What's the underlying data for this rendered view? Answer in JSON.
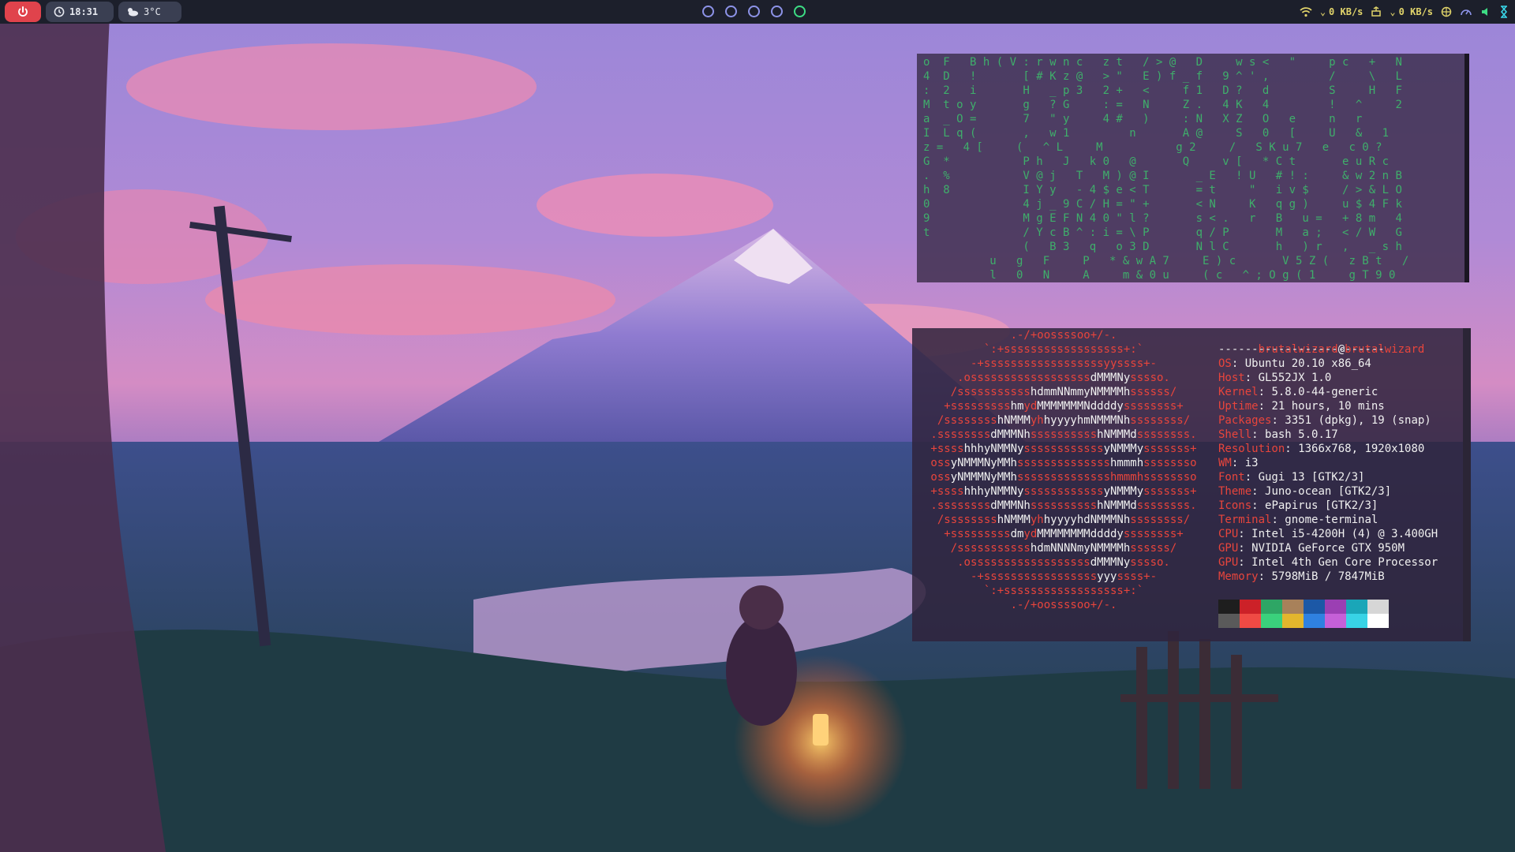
{
  "topbar": {
    "power_icon": "power-icon",
    "clock_icon": "clock-icon",
    "time": "18:31",
    "weather_icon": "cloud-sun-icon",
    "temperature": "3°C",
    "workspaces": [
      {
        "id": 1,
        "active": false
      },
      {
        "id": 2,
        "active": false
      },
      {
        "id": 3,
        "active": false
      },
      {
        "id": 4,
        "active": false
      },
      {
        "id": 5,
        "active": true
      }
    ],
    "tray": {
      "wifi_icon": "wifi-icon",
      "download_rate": "0 KB/s",
      "network_icon": "ethernet-icon",
      "upload_rate": "0 KB/s",
      "extra_icons": [
        "globe-icon",
        "speedometer-icon",
        "volume-icon",
        "hourglass-icon"
      ]
    },
    "colors": {
      "power": "#e0434c",
      "accent": "#e0d36a",
      "active_ws": "#3ddc84",
      "ws": "#8d93e8"
    }
  },
  "matrix": {
    "color": "#3fae6b",
    "rows": [
      "o  F   B h ( V : r w n c   z t   / > @   D     w s <   \"     p c   +   N",
      "4  D   !       [ # K z @   > \"   E ) f _ f   9 ^ ' ,         /     \\   L",
      ":  2   i       H   _ p 3   2 +   <     f 1   D ?   d         S     H   F",
      "M  t o y       g   ? G     : =   N     Z .   4 K   4         !   ^     2",
      "a  _ O =       7   \" y     4 #   )     : N   X Z   O   e     n   r     ",
      "I  L q (       ,   w 1         n       A @     S   0   [     U   &   1",
      "z =   4 [     (   ^ L     M           g 2     /   S K u 7   e   c 0 ?  ",
      "G  *           P h   J   k 0   @       Q     v [   * C t       e u R c",
      ".  %           V @ j   T   M ) @ I       _ E   ! U   # ! :     & w 2 n B",
      "h  8           I Y y   - 4 $ e < T       = t     \"   i v $     / > & L O",
      "0              4 j _ 9 C / H = \" +       < N     K   q g )     u $ 4 F k",
      "9              M g E F N 4 0 \" l ?       s < .   r   B   u =   + 8 m   4",
      "t              / Y c B ^ : i = \\ P       q / P       M   a ;   < / W   G",
      "               (   B 3   q   o 3 D       N l C       h   ) r   ,   _ s h",
      "          u   g   F     P   * & w A 7     E ) c       V 5 Z (   z B t   /",
      "          l   0   N     A     m & 0 u     ( c   ^ ; O g ( 1     g T 9 0"
    ]
  },
  "neofetch": {
    "username": "brutalwizard",
    "at": "@",
    "hostname": "brutalwizard",
    "separator": "-------------------------",
    "info": [
      {
        "key": "OS",
        "value": "Ubuntu 20.10 x86_64"
      },
      {
        "key": "Host",
        "value": "GL552JX 1.0"
      },
      {
        "key": "Kernel",
        "value": "5.8.0-44-generic"
      },
      {
        "key": "Uptime",
        "value": "21 hours, 10 mins"
      },
      {
        "key": "Packages",
        "value": "3351 (dpkg), 19 (snap)"
      },
      {
        "key": "Shell",
        "value": "bash 5.0.17"
      },
      {
        "key": "Resolution",
        "value": "1366x768, 1920x1080"
      },
      {
        "key": "WM",
        "value": "i3"
      },
      {
        "key": "Font",
        "value": "Gugi 13 [GTK2/3]"
      },
      {
        "key": "Theme",
        "value": "Juno-ocean [GTK2/3]"
      },
      {
        "key": "Icons",
        "value": "ePapirus [GTK2/3]"
      },
      {
        "key": "Terminal",
        "value": "gnome-terminal"
      },
      {
        "key": "CPU",
        "value": "Intel i5-4200H (4) @ 3.400GH"
      },
      {
        "key": "GPU",
        "value": "NVIDIA GeForce GTX 950M"
      },
      {
        "key": "GPU",
        "value": "Intel 4th Gen Core Processor"
      },
      {
        "key": "Memory",
        "value": "5798MiB / 7847MiB"
      }
    ],
    "logo": [
      [
        {
          "t": ".-/+oossssoo+/-.",
          "c": "r"
        }
      ],
      [
        {
          "t": "`:+ssssssssssssssssss+:`",
          "c": "r"
        }
      ],
      [
        {
          "t": "-+ssssssssssssssssssyyssss+-",
          "c": "r"
        }
      ],
      [
        {
          "t": ".ossssssssssssssssss",
          "c": "r"
        },
        {
          "t": "dMMMNy",
          "c": "w"
        },
        {
          "t": "sssso.",
          "c": "r"
        }
      ],
      [
        {
          "t": "/sssssssssss",
          "c": "r"
        },
        {
          "t": "hdmmNNmmyNMMMMh",
          "c": "w"
        },
        {
          "t": "ssssss/",
          "c": "r"
        }
      ],
      [
        {
          "t": "+sssssssss",
          "c": "r"
        },
        {
          "t": "hm",
          "c": "w"
        },
        {
          "t": "yd",
          "c": "r"
        },
        {
          "t": "MMMMMMMNddddy",
          "c": "w"
        },
        {
          "t": "ssssssss+",
          "c": "r"
        }
      ],
      [
        {
          "t": "/ssssssss",
          "c": "r"
        },
        {
          "t": "hNMMM",
          "c": "w"
        },
        {
          "t": "yh",
          "c": "r"
        },
        {
          "t": "hyyyyhmNMMMNh",
          "c": "w"
        },
        {
          "t": "ssssssss/",
          "c": "r"
        }
      ],
      [
        {
          "t": ".ssssssss",
          "c": "r"
        },
        {
          "t": "dMMMNh",
          "c": "w"
        },
        {
          "t": "ssssssssss",
          "c": "r"
        },
        {
          "t": "hNMMMd",
          "c": "w"
        },
        {
          "t": "ssssssss.",
          "c": "r"
        }
      ],
      [
        {
          "t": "+ssss",
          "c": "r"
        },
        {
          "t": "hhhyNMMNy",
          "c": "w"
        },
        {
          "t": "ssssssssssss",
          "c": "r"
        },
        {
          "t": "yNMMMy",
          "c": "w"
        },
        {
          "t": "sssssss+",
          "c": "r"
        }
      ],
      [
        {
          "t": "oss",
          "c": "r"
        },
        {
          "t": "yNMMMNyMMh",
          "c": "w"
        },
        {
          "t": "ssssssssssssss",
          "c": "r"
        },
        {
          "t": "hmmmh",
          "c": "w"
        },
        {
          "t": "ssssssso",
          "c": "r"
        }
      ],
      [
        {
          "t": "oss",
          "c": "r"
        },
        {
          "t": "yNMMMNyMMh",
          "c": "w"
        },
        {
          "t": "sssssssssssssshmmmh",
          "c": "r"
        },
        {
          "t": "ssssssso",
          "c": "r"
        }
      ],
      [
        {
          "t": "+ssss",
          "c": "r"
        },
        {
          "t": "hhhyNMMNy",
          "c": "w"
        },
        {
          "t": "ssssssssssss",
          "c": "r"
        },
        {
          "t": "yNMMMy",
          "c": "w"
        },
        {
          "t": "sssssss+",
          "c": "r"
        }
      ],
      [
        {
          "t": ".ssssssss",
          "c": "r"
        },
        {
          "t": "dMMMNh",
          "c": "w"
        },
        {
          "t": "ssssssssss",
          "c": "r"
        },
        {
          "t": "hNMMMd",
          "c": "w"
        },
        {
          "t": "ssssssss.",
          "c": "r"
        }
      ],
      [
        {
          "t": "/ssssssss",
          "c": "r"
        },
        {
          "t": "hNMMM",
          "c": "w"
        },
        {
          "t": "yh",
          "c": "r"
        },
        {
          "t": "hyyyyhdNMMMNh",
          "c": "w"
        },
        {
          "t": "ssssssss/",
          "c": "r"
        }
      ],
      [
        {
          "t": "+sssssssss",
          "c": "r"
        },
        {
          "t": "dm",
          "c": "w"
        },
        {
          "t": "yd",
          "c": "r"
        },
        {
          "t": "MMMMMMMMddddy",
          "c": "w"
        },
        {
          "t": "ssssssss+",
          "c": "r"
        }
      ],
      [
        {
          "t": "/sssssssssss",
          "c": "r"
        },
        {
          "t": "hdmNNNNmyNMMMMh",
          "c": "w"
        },
        {
          "t": "ssssss/",
          "c": "r"
        }
      ],
      [
        {
          "t": ".ossssssssssssssssss",
          "c": "r"
        },
        {
          "t": "dMMMNy",
          "c": "w"
        },
        {
          "t": "sssso.",
          "c": "r"
        }
      ],
      [
        {
          "t": "-+sssssssssssssssss",
          "c": "r"
        },
        {
          "t": "yyy",
          "c": "w"
        },
        {
          "t": "ssss+-",
          "c": "r"
        }
      ],
      [
        {
          "t": "`:+ssssssssssssssssss+:`",
          "c": "r"
        }
      ],
      [
        {
          "t": ".-/+oossssoo+/-.",
          "c": "r"
        }
      ]
    ],
    "palette": {
      "row1": [
        "#1e1e1e",
        "#cc2128",
        "#2ea665",
        "#a8815a",
        "#1c58a6",
        "#9b3fb3",
        "#1aa6b8",
        "#d6d6d6"
      ],
      "row2": [
        "#5a5a5a",
        "#ef4a44",
        "#3ad17c",
        "#e3b62d",
        "#2f81e0",
        "#c560d8",
        "#38d3e6",
        "#ffffff"
      ]
    },
    "key_color": "#e8453c"
  }
}
